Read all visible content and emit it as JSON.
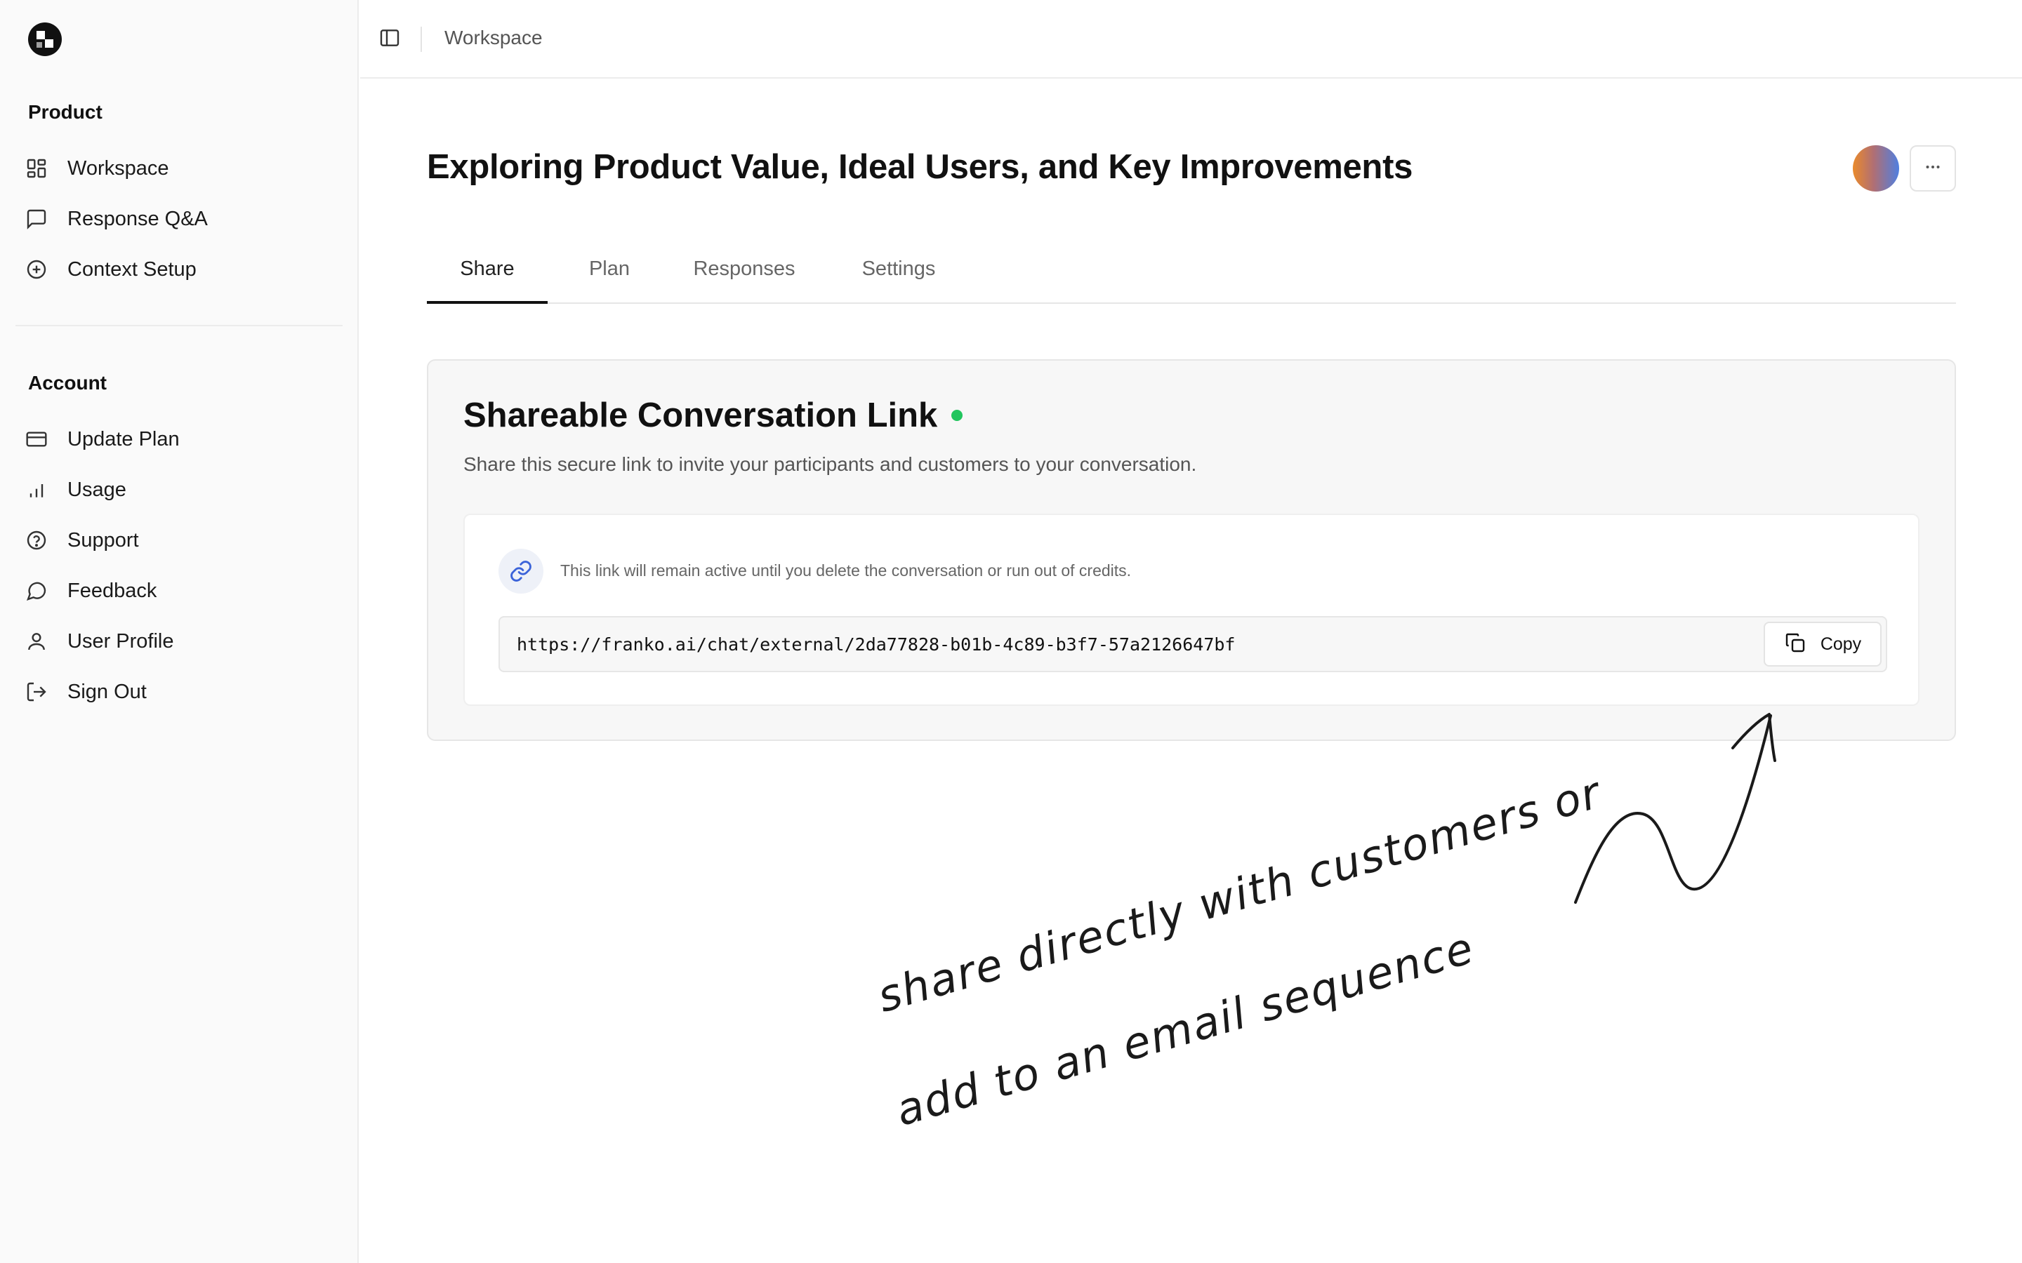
{
  "sidebar": {
    "product_label": "Product",
    "product_items": [
      {
        "label": "Workspace",
        "icon": "grid-icon"
      },
      {
        "label": "Response Q&A",
        "icon": "message-square-icon"
      },
      {
        "label": "Context Setup",
        "icon": "plus-circle-icon"
      }
    ],
    "account_label": "Account",
    "account_items": [
      {
        "label": "Update Plan",
        "icon": "credit-card-icon"
      },
      {
        "label": "Usage",
        "icon": "bar-chart-icon"
      },
      {
        "label": "Support",
        "icon": "help-circle-icon"
      },
      {
        "label": "Feedback",
        "icon": "message-circle-icon"
      },
      {
        "label": "User Profile",
        "icon": "user-icon"
      },
      {
        "label": "Sign Out",
        "icon": "log-out-icon"
      }
    ]
  },
  "topbar": {
    "breadcrumb": "Workspace"
  },
  "page": {
    "title": "Exploring Product Value, Ideal Users, and Key Improvements"
  },
  "tabs": [
    {
      "label": "Share",
      "active": true
    },
    {
      "label": "Plan",
      "active": false
    },
    {
      "label": "Responses",
      "active": false
    },
    {
      "label": "Settings",
      "active": false
    }
  ],
  "share_card": {
    "title": "Shareable Conversation Link",
    "status_color": "#22c55e",
    "description": "Share this secure link to invite your participants and customers to your conversation.",
    "note": "This link will remain active until you delete the conversation or run out of credits.",
    "url": "https://franko.ai/chat/external/2da77828-b01b-4c89-b3f7-57a2126647bf",
    "copy_label": "Copy"
  },
  "annotation": {
    "line1": "share directly with customers or",
    "line2": "add to an email sequence"
  },
  "colors": {
    "accent_link": "#3b63d9",
    "avatar_gradient": [
      "#ea8a2b",
      "#4f7fe0"
    ]
  }
}
